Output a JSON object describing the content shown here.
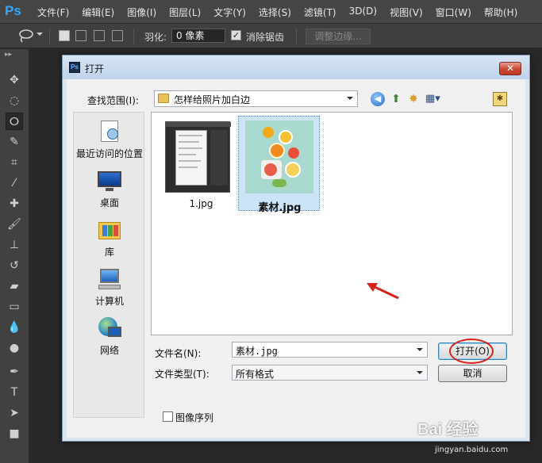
{
  "app": {
    "logo": "Ps"
  },
  "menu": [
    "文件(F)",
    "编辑(E)",
    "图像(I)",
    "图层(L)",
    "文字(Y)",
    "选择(S)",
    "滤镜(T)",
    "3D(D)",
    "视图(V)",
    "窗口(W)",
    "帮助(H)"
  ],
  "options": {
    "feather_label": "羽化:",
    "feather_value": "0 像素",
    "antialias_label": "消除锯齿",
    "antialias_checked": true,
    "refine_edge_label": "调整边缘..."
  },
  "tools": [
    "move-tool",
    "marquee-tool",
    "lasso-tool",
    "quick-select-tool",
    "crop-tool",
    "eyedropper-tool",
    "healing-tool",
    "brush-tool",
    "clone-stamp-tool",
    "history-brush-tool",
    "eraser-tool",
    "gradient-tool",
    "blur-tool",
    "dodge-tool",
    "pen-tool",
    "type-tool",
    "path-select-tool",
    "rectangle-tool"
  ],
  "dialog": {
    "title": "打开",
    "lookin_label": "查找范围(I):",
    "lookin_value": "怎样给照片加白边",
    "places": [
      {
        "label": "最近访问的位置",
        "icon": "recent-places-icon"
      },
      {
        "label": "桌面",
        "icon": "desktop-icon"
      },
      {
        "label": "库",
        "icon": "libraries-icon"
      },
      {
        "label": "计算机",
        "icon": "computer-icon"
      },
      {
        "label": "网络",
        "icon": "network-icon"
      }
    ],
    "files": [
      {
        "name": "1.jpg",
        "selected": false
      },
      {
        "name": "素材.jpg",
        "selected": true
      }
    ],
    "filename_label": "文件名(N):",
    "filename_value": "素材.jpg",
    "filetype_label": "文件类型(T):",
    "filetype_value": "所有格式",
    "open_label": "打开(O)",
    "cancel_label": "取消",
    "image_sequence_label": "图像序列",
    "image_sequence_checked": false
  },
  "watermark": {
    "brand": "Bai 经验",
    "site": "jingyan.baidu.com"
  },
  "colors": {
    "annotation_red": "#d8231d",
    "selection_blue": "#cce4f7",
    "ps_blue": "#31a8ff"
  }
}
